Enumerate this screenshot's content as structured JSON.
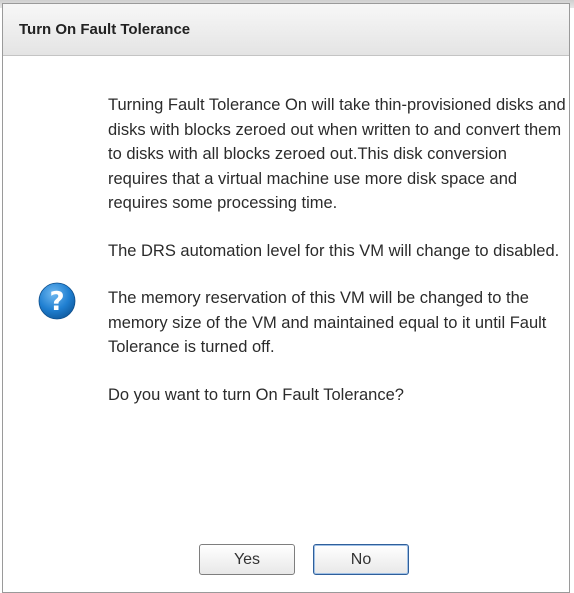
{
  "dialog": {
    "title": "Turn On Fault Tolerance",
    "messages": [
      "Turning Fault Tolerance On will take thin-provisioned disks and disks with blocks zeroed out when written to and convert them to disks with all blocks zeroed out.This disk conversion requires that a virtual machine use more disk space and requires some processing time.",
      "The DRS automation level for this VM will change to disabled.",
      "The memory reservation of this VM will be changed to the memory size of the VM and maintained equal to it until Fault Tolerance is turned off."
    ],
    "question": "Do you want to turn On Fault Tolerance?",
    "icon": "question-icon",
    "yes_label": "Yes",
    "no_label": "No",
    "accent_color": "#1f7fd1"
  }
}
